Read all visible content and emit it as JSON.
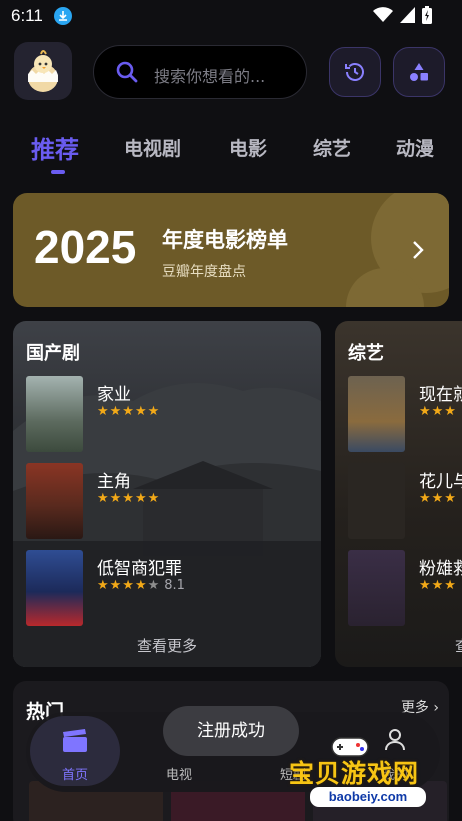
{
  "status_bar": {
    "time": "6:11"
  },
  "search": {
    "placeholder": "搜索你想看的..."
  },
  "tabs": [
    {
      "label": "推荐"
    },
    {
      "label": "电视剧"
    },
    {
      "label": "电影"
    },
    {
      "label": "综艺"
    },
    {
      "label": "动漫"
    }
  ],
  "banner": {
    "year": "2025",
    "title": "年度电影榜单",
    "subtitle": "豆瓣年度盘点"
  },
  "card_domestic": {
    "title": "国产剧",
    "items": [
      {
        "name": "家业",
        "stars": "★★★★★",
        "stars_empty": "",
        "score": ""
      },
      {
        "name": "主角",
        "stars": "★★★★★",
        "stars_empty": "",
        "score": ""
      },
      {
        "name": "低智商犯罪",
        "stars": "★★★★",
        "stars_empty": "★",
        "score": "8.1"
      }
    ],
    "more": "查看更多"
  },
  "card_variety": {
    "title": "综艺",
    "items": [
      {
        "name": "现在就",
        "stars": "★★★"
      },
      {
        "name": "花儿与",
        "stars": "★★★"
      },
      {
        "name": "粉雄救",
        "stars": "★★★"
      }
    ],
    "more": "查"
  },
  "hot": {
    "title": "热门",
    "more": "更多"
  },
  "bottom_nav": [
    {
      "label": "首页"
    },
    {
      "label": "电视"
    },
    {
      "label": "短剧"
    },
    {
      "label": "我的"
    }
  ],
  "toast": "注册成功",
  "watermark": {
    "text": "宝贝游戏网",
    "url": "baobeiy.com"
  },
  "colors": {
    "accent": "#6a5cf0",
    "star": "#f2a918",
    "banner": "#6d5a28"
  }
}
